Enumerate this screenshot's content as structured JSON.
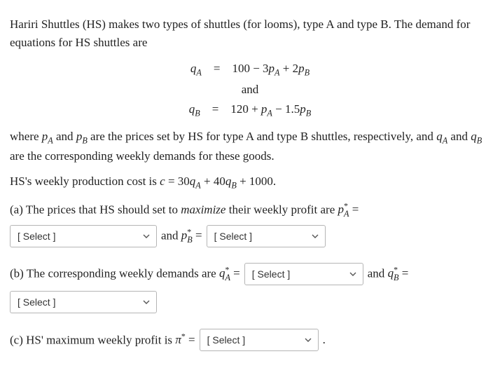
{
  "intro": "Hariri Shuttles (HS) makes two types of shuttles (for looms), type A and type B. The demand for equations for HS shuttles are",
  "eq": {
    "qA_lhs": "q",
    "qA_sub": "A",
    "eq_sign": "=",
    "qA_rhs_1": "100 − 3",
    "pA": "p",
    "pA_sub": "A",
    "plus": " + 2",
    "pB": "p",
    "pB_sub": "B",
    "and": "and",
    "qB_lhs": "q",
    "qB_sub": "B",
    "qB_rhs_1": "120 + ",
    "minus": " − 1.5"
  },
  "where_1": "where ",
  "where_2": " and ",
  "where_3": " are the prices set by HS for type A and type B shuttles, respectively, and ",
  "where_4": " and ",
  "where_5": " are the corresponding weekly demands for these goods.",
  "cost_1": "HS's weekly production cost is ",
  "cost_c": "c",
  "cost_eq": " = 30",
  "cost_qA": "q",
  "cost_qA_sub": "A",
  "cost_plus": " + 40",
  "cost_qB": "q",
  "cost_qB_sub": "B",
  "cost_end": " + 1000.",
  "a_text_1": "(a) The prices that HS should set to ",
  "a_max": "maximize",
  "a_text_2": " their weekly profit are ",
  "a_pA": "p",
  "a_star": "*",
  "a_sub": "A",
  "eqsym": " = ",
  "and_word": " and ",
  "a_pB": "p",
  "a_pB_sub": "B",
  "b_text": "(b) The corresponding weekly demands are ",
  "b_qA": "q",
  "b_qA_sub": "A",
  "b_qB": "q",
  "b_qB_sub": "B",
  "c_text": "(c) HS' maximum weekly profit is ",
  "c_pi": "π",
  "period": ".",
  "select_placeholder": "[ Select ]"
}
